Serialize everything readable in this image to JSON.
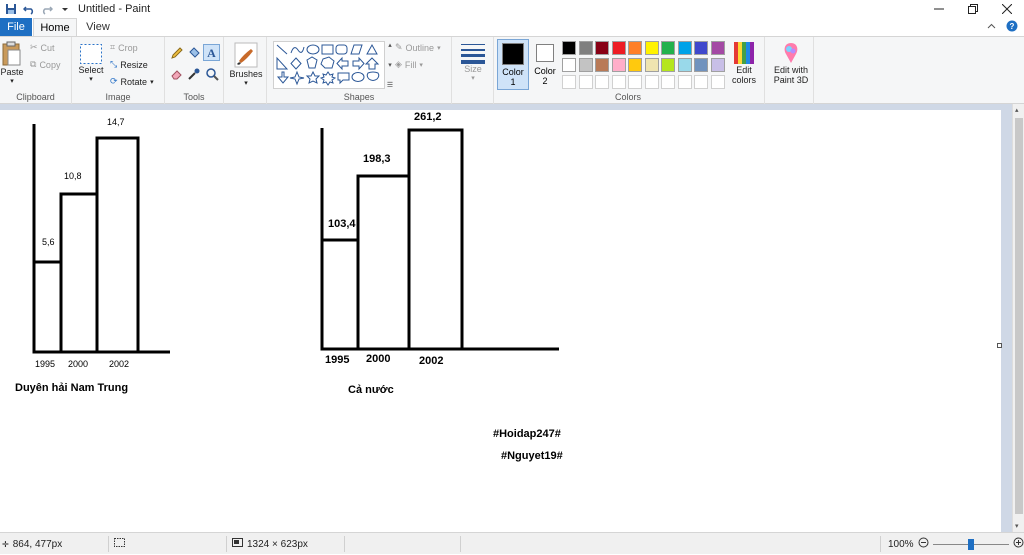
{
  "window": {
    "title": "Untitled - Paint"
  },
  "tabs": {
    "file": "File",
    "home": "Home",
    "view": "View"
  },
  "ribbon": {
    "clipboard": {
      "label": "Clipboard",
      "paste": "Paste",
      "cut": "Cut",
      "copy": "Copy"
    },
    "image": {
      "label": "Image",
      "select": "Select",
      "crop": "Crop",
      "resize": "Resize",
      "rotate": "Rotate"
    },
    "tools": {
      "label": "Tools"
    },
    "brushes": {
      "label": "Brushes"
    },
    "shapes": {
      "label": "Shapes",
      "outline": "Outline",
      "fill": "Fill"
    },
    "size": {
      "label": "Size"
    },
    "colors": {
      "label": "Colors",
      "color1": "Color",
      "color1_num": "1",
      "color2": "Color",
      "color2_num": "2",
      "edit_colors_1": "Edit",
      "edit_colors_2": "colors",
      "edit3d_1": "Edit with",
      "edit3d_2": "Paint 3D",
      "color1_value": "#000000",
      "color2_value": "#ffffff",
      "palette_row1": [
        "#000000",
        "#7f7f7f",
        "#880015",
        "#ed1c24",
        "#ff7f27",
        "#fff200",
        "#22b14c",
        "#00a2e8",
        "#3f48cc",
        "#a349a4"
      ],
      "palette_row2": [
        "#ffffff",
        "#c3c3c3",
        "#b97a57",
        "#ffaec9",
        "#ffc90e",
        "#efe4b0",
        "#b5e61d",
        "#99d9ea",
        "#7092be",
        "#c8bfe7"
      ],
      "palette_row3": [
        "#ffffff",
        "#ffffff",
        "#ffffff",
        "#ffffff",
        "#ffffff",
        "#ffffff",
        "#ffffff",
        "#ffffff",
        "#ffffff",
        "#ffffff"
      ]
    }
  },
  "drawing": {
    "chart_left": {
      "categories": [
        "1995",
        "2000",
        "2002"
      ],
      "values": [
        "5,6",
        "10,8",
        "14,7"
      ],
      "caption": "Duyên hải Nam Trung"
    },
    "chart_right": {
      "categories": [
        "1995",
        "2000",
        "2002"
      ],
      "values": [
        "103,4",
        "198,3",
        "261,2"
      ],
      "caption": "Cả nước"
    },
    "tag1": "#Hoidap247#",
    "tag2": "#Nguyet19#"
  },
  "status": {
    "cursor_pos": "864, 477px",
    "canvas_size": "1324 × 623px",
    "zoom": "100%",
    "zoom_slider_percent": 100
  }
}
